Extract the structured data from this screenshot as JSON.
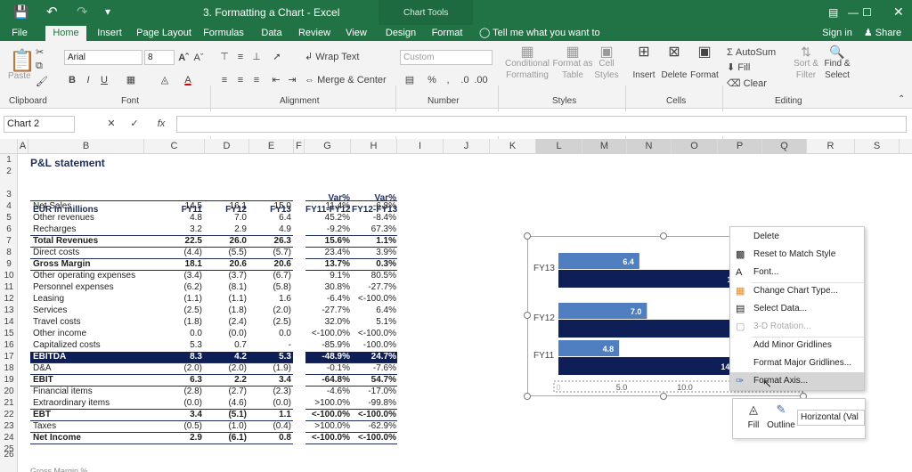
{
  "app": {
    "title": "3. Formatting a Chart - Excel",
    "contextual_tab": "Chart Tools",
    "signin": "Sign in",
    "share": "Share"
  },
  "tabs": [
    "File",
    "Home",
    "Insert",
    "Page Layout",
    "Formulas",
    "Data",
    "Review",
    "View",
    "Design",
    "Format"
  ],
  "tell_me": "Tell me what you want to do...",
  "ribbon": {
    "clipboard": {
      "paste": "Paste",
      "label": "Clipboard"
    },
    "font": {
      "family": "Arial",
      "size": "8",
      "label": "Font"
    },
    "alignment": {
      "wrap": "Wrap Text",
      "merge": "Merge & Center",
      "label": "Alignment"
    },
    "number": {
      "format": "Custom",
      "label": "Number"
    },
    "styles": {
      "conditional": "Conditional",
      "formatting": "Formatting",
      "format_as": "Format as",
      "table": "Table",
      "cell": "Cell",
      "styles_word": "Styles",
      "label": "Styles"
    },
    "cells": {
      "insert": "Insert",
      "delete": "Delete",
      "format": "Format",
      "label": "Cells"
    },
    "editing": {
      "autosum": "AutoSum",
      "fill": "Fill",
      "clear": "Clear",
      "sort": "Sort &",
      "filter": "Filter",
      "find": "Find &",
      "select": "Select",
      "label": "Editing"
    }
  },
  "namebox": "Chart 2",
  "fx": "fx",
  "columns": [
    "A",
    "B",
    "C",
    "D",
    "E",
    "F",
    "G",
    "H",
    "I",
    "J",
    "K",
    "L",
    "M",
    "N",
    "O",
    "P",
    "Q",
    "R",
    "S"
  ],
  "rows": [
    "1",
    "2",
    "3",
    "4",
    "5",
    "6",
    "7",
    "8",
    "9",
    "10",
    "11",
    "12",
    "13",
    "14",
    "15",
    "16",
    "17",
    "18",
    "19",
    "20",
    "21",
    "22",
    "23",
    "24",
    "25",
    "26"
  ],
  "sheet": {
    "title": "P&L statement",
    "header": {
      "label": "EUR in millions",
      "fy11": "FY11",
      "fy12": "FY12",
      "fy13": "FY13",
      "var1a": "Var%",
      "var1b": "FY11-FY12",
      "var2a": "Var%",
      "var2b": "FY12-FY13"
    },
    "lines": [
      [
        "Net Sales",
        "14.5",
        "16.1",
        "15.0",
        "11.4%",
        "-6.8%"
      ],
      [
        "Other revenues",
        "4.8",
        "7.0",
        "6.4",
        "45.2%",
        "-8.4%"
      ],
      [
        "Recharges",
        "3.2",
        "2.9",
        "4.9",
        "-9.2%",
        "67.3%"
      ],
      [
        "Total Revenues",
        "22.5",
        "26.0",
        "26.3",
        "15.6%",
        "1.1%"
      ],
      [
        "Direct costs",
        "(4.4)",
        "(5.5)",
        "(5.7)",
        "23.4%",
        "3.9%"
      ],
      [
        "Gross Margin",
        "18.1",
        "20.6",
        "20.6",
        "13.7%",
        "0.3%"
      ],
      [
        "Other operating expenses",
        "(3.4)",
        "(3.7)",
        "(6.7)",
        "9.1%",
        "80.5%"
      ],
      [
        "Personnel expenses",
        "(6.2)",
        "(8.1)",
        "(5.8)",
        "30.8%",
        "-27.7%"
      ],
      [
        "Leasing",
        "(1.1)",
        "(1.1)",
        "1.6",
        "-6.4%",
        "<-100.0%"
      ],
      [
        "Services",
        "(2.5)",
        "(1.8)",
        "(2.0)",
        "-27.7%",
        "6.4%"
      ],
      [
        "Travel costs",
        "(1.8)",
        "(2.4)",
        "(2.5)",
        "32.0%",
        "5.1%"
      ],
      [
        "Other income",
        "0.0",
        "(0.0)",
        "0.0",
        "<-100.0%",
        "<-100.0%"
      ],
      [
        "Capitalized costs",
        "5.3",
        "0.7",
        "-",
        "-85.9%",
        "-100.0%"
      ],
      [
        "EBITDA",
        "8.3",
        "4.2",
        "5.3",
        "-48.9%",
        "24.7%"
      ],
      [
        "D&A",
        "(2.0)",
        "(2.0)",
        "(1.9)",
        "-0.1%",
        "-7.6%"
      ],
      [
        "EBIT",
        "6.3",
        "2.2",
        "3.4",
        "-64.8%",
        "54.7%"
      ],
      [
        "Financial items",
        "(2.8)",
        "(2.7)",
        "(2.3)",
        "-4.6%",
        "-17.0%"
      ],
      [
        "Extraordinary items",
        "(0.0)",
        "(4.6)",
        "(0.0)",
        ">100.0%",
        "-99.8%"
      ],
      [
        "EBT",
        "3.4",
        "(5.1)",
        "1.1",
        "<-100.0%",
        "<-100.0%"
      ],
      [
        "Taxes",
        "(0.5)",
        "(1.0)",
        "(0.4)",
        ">100.0%",
        "-62.9%"
      ],
      [
        "Net Income",
        "2.9",
        "(6.1)",
        "0.8",
        "<-100.0%",
        "<-100.0%"
      ]
    ],
    "row26": "Gross Margin %"
  },
  "chart_data": {
    "type": "bar",
    "categories": [
      "FY11",
      "FY12",
      "FY13"
    ],
    "series": [
      {
        "values": [
          4.8,
          7.0,
          6.4
        ]
      },
      {
        "values": [
          14.5,
          16.1,
          15.0
        ]
      }
    ],
    "data_labels": [
      [
        "4.8",
        "14.5"
      ],
      [
        "7.0",
        "16."
      ],
      [
        "6.4",
        "15.0"
      ]
    ],
    "xlim": [
      0,
      20
    ],
    "x_ticks": [
      "0",
      "5.0",
      "10.0",
      "15.0",
      "20.0"
    ],
    "colors": {
      "light": "#4f7ec1",
      "dark": "#0e1f57"
    }
  },
  "context_menu": [
    "Delete",
    "Reset to Match Style",
    "Font...",
    "Change Chart Type...",
    "Select Data...",
    "3-D Rotation...",
    "Add Minor Gridlines",
    "Format Major Gridlines...",
    "Format Axis..."
  ],
  "mini_toolbar": {
    "fill": "Fill",
    "outline": "Outline",
    "dropdown": "Horizontal (Val"
  }
}
